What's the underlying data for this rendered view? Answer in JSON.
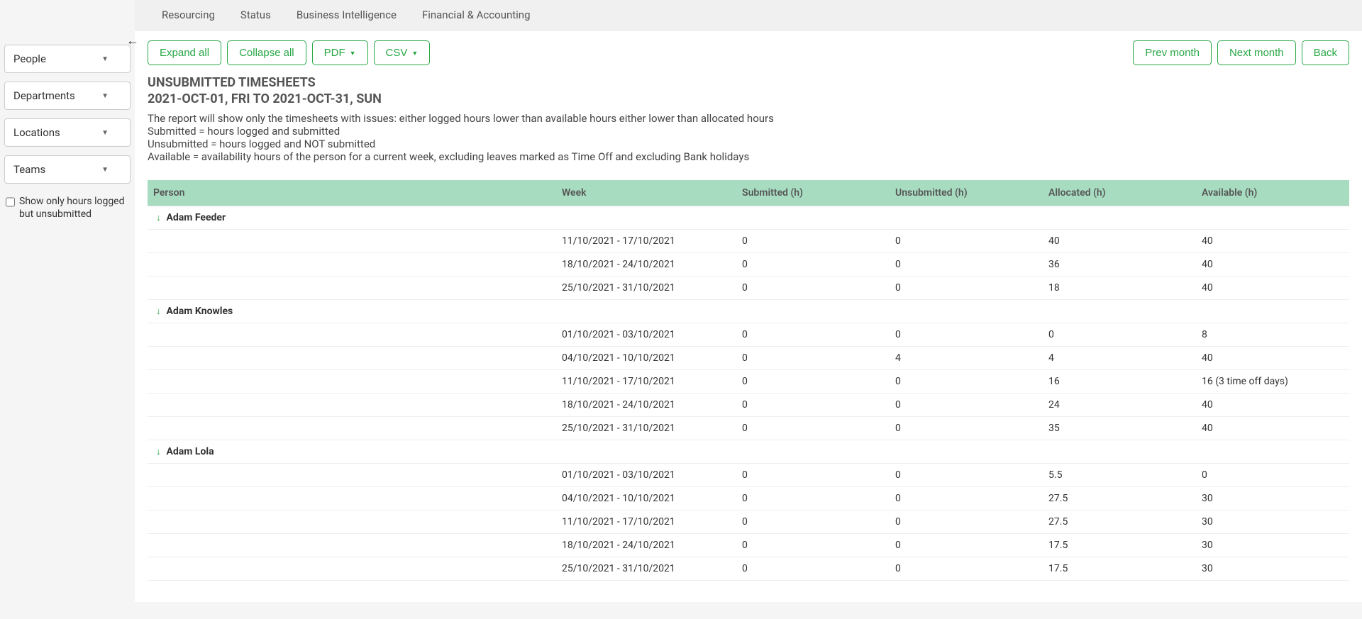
{
  "topnav": {
    "items": [
      {
        "label": "Resourcing"
      },
      {
        "label": "Status"
      },
      {
        "label": "Business Intelligence"
      },
      {
        "label": "Financial & Accounting"
      }
    ]
  },
  "sidebar": {
    "filters": [
      {
        "label": "People"
      },
      {
        "label": "Departments"
      },
      {
        "label": "Locations"
      },
      {
        "label": "Teams"
      }
    ],
    "checkbox_label": "Show only hours logged but unsubmitted"
  },
  "toolbar": {
    "expand_all": "Expand all",
    "collapse_all": "Collapse all",
    "pdf": "PDF",
    "csv": "CSV",
    "prev_month": "Prev month",
    "next_month": "Next month",
    "back": "Back"
  },
  "page": {
    "title": "UNSUBMITTED TIMESHEETS",
    "subtitle": "2021-OCT-01, FRI TO 2021-OCT-31, SUN",
    "desc_line1": "The report will show only the timesheets with issues: either logged hours lower than available hours either lower than allocated hours",
    "desc_line2": "Submitted = hours logged and submitted",
    "desc_line3": "Unsubmitted = hours logged and NOT submitted",
    "desc_line4": "Available = availability hours of the person for a current week, excluding leaves marked as Time Off and excluding Bank holidays"
  },
  "table": {
    "headers": {
      "person": "Person",
      "week": "Week",
      "submitted": "Submitted (h)",
      "unsubmitted": "Unsubmitted (h)",
      "allocated": "Allocated (h)",
      "available": "Available (h)"
    },
    "groups": [
      {
        "person": "Adam Feeder",
        "rows": [
          {
            "week": "11/10/2021 - 17/10/2021",
            "submitted": "0",
            "unsubmitted": "0",
            "allocated": "40",
            "available": "40"
          },
          {
            "week": "18/10/2021 - 24/10/2021",
            "submitted": "0",
            "unsubmitted": "0",
            "allocated": "36",
            "available": "40"
          },
          {
            "week": "25/10/2021 - 31/10/2021",
            "submitted": "0",
            "unsubmitted": "0",
            "allocated": "18",
            "available": "40"
          }
        ]
      },
      {
        "person": "Adam Knowles",
        "rows": [
          {
            "week": "01/10/2021 - 03/10/2021",
            "submitted": "0",
            "unsubmitted": "0",
            "allocated": "0",
            "available": "8"
          },
          {
            "week": "04/10/2021 - 10/10/2021",
            "submitted": "0",
            "unsubmitted": "4",
            "allocated": "4",
            "available": "40"
          },
          {
            "week": "11/10/2021 - 17/10/2021",
            "submitted": "0",
            "unsubmitted": "0",
            "allocated": "16",
            "available": "16 (3 time off days)"
          },
          {
            "week": "18/10/2021 - 24/10/2021",
            "submitted": "0",
            "unsubmitted": "0",
            "allocated": "24",
            "available": "40"
          },
          {
            "week": "25/10/2021 - 31/10/2021",
            "submitted": "0",
            "unsubmitted": "0",
            "allocated": "35",
            "available": "40"
          }
        ]
      },
      {
        "person": "Adam Lola",
        "rows": [
          {
            "week": "01/10/2021 - 03/10/2021",
            "submitted": "0",
            "unsubmitted": "0",
            "allocated": "5.5",
            "available": "0"
          },
          {
            "week": "04/10/2021 - 10/10/2021",
            "submitted": "0",
            "unsubmitted": "0",
            "allocated": "27.5",
            "available": "30"
          },
          {
            "week": "11/10/2021 - 17/10/2021",
            "submitted": "0",
            "unsubmitted": "0",
            "allocated": "27.5",
            "available": "30"
          },
          {
            "week": "18/10/2021 - 24/10/2021",
            "submitted": "0",
            "unsubmitted": "0",
            "allocated": "17.5",
            "available": "30"
          },
          {
            "week": "25/10/2021 - 31/10/2021",
            "submitted": "0",
            "unsubmitted": "0",
            "allocated": "17.5",
            "available": "30"
          }
        ]
      }
    ]
  }
}
